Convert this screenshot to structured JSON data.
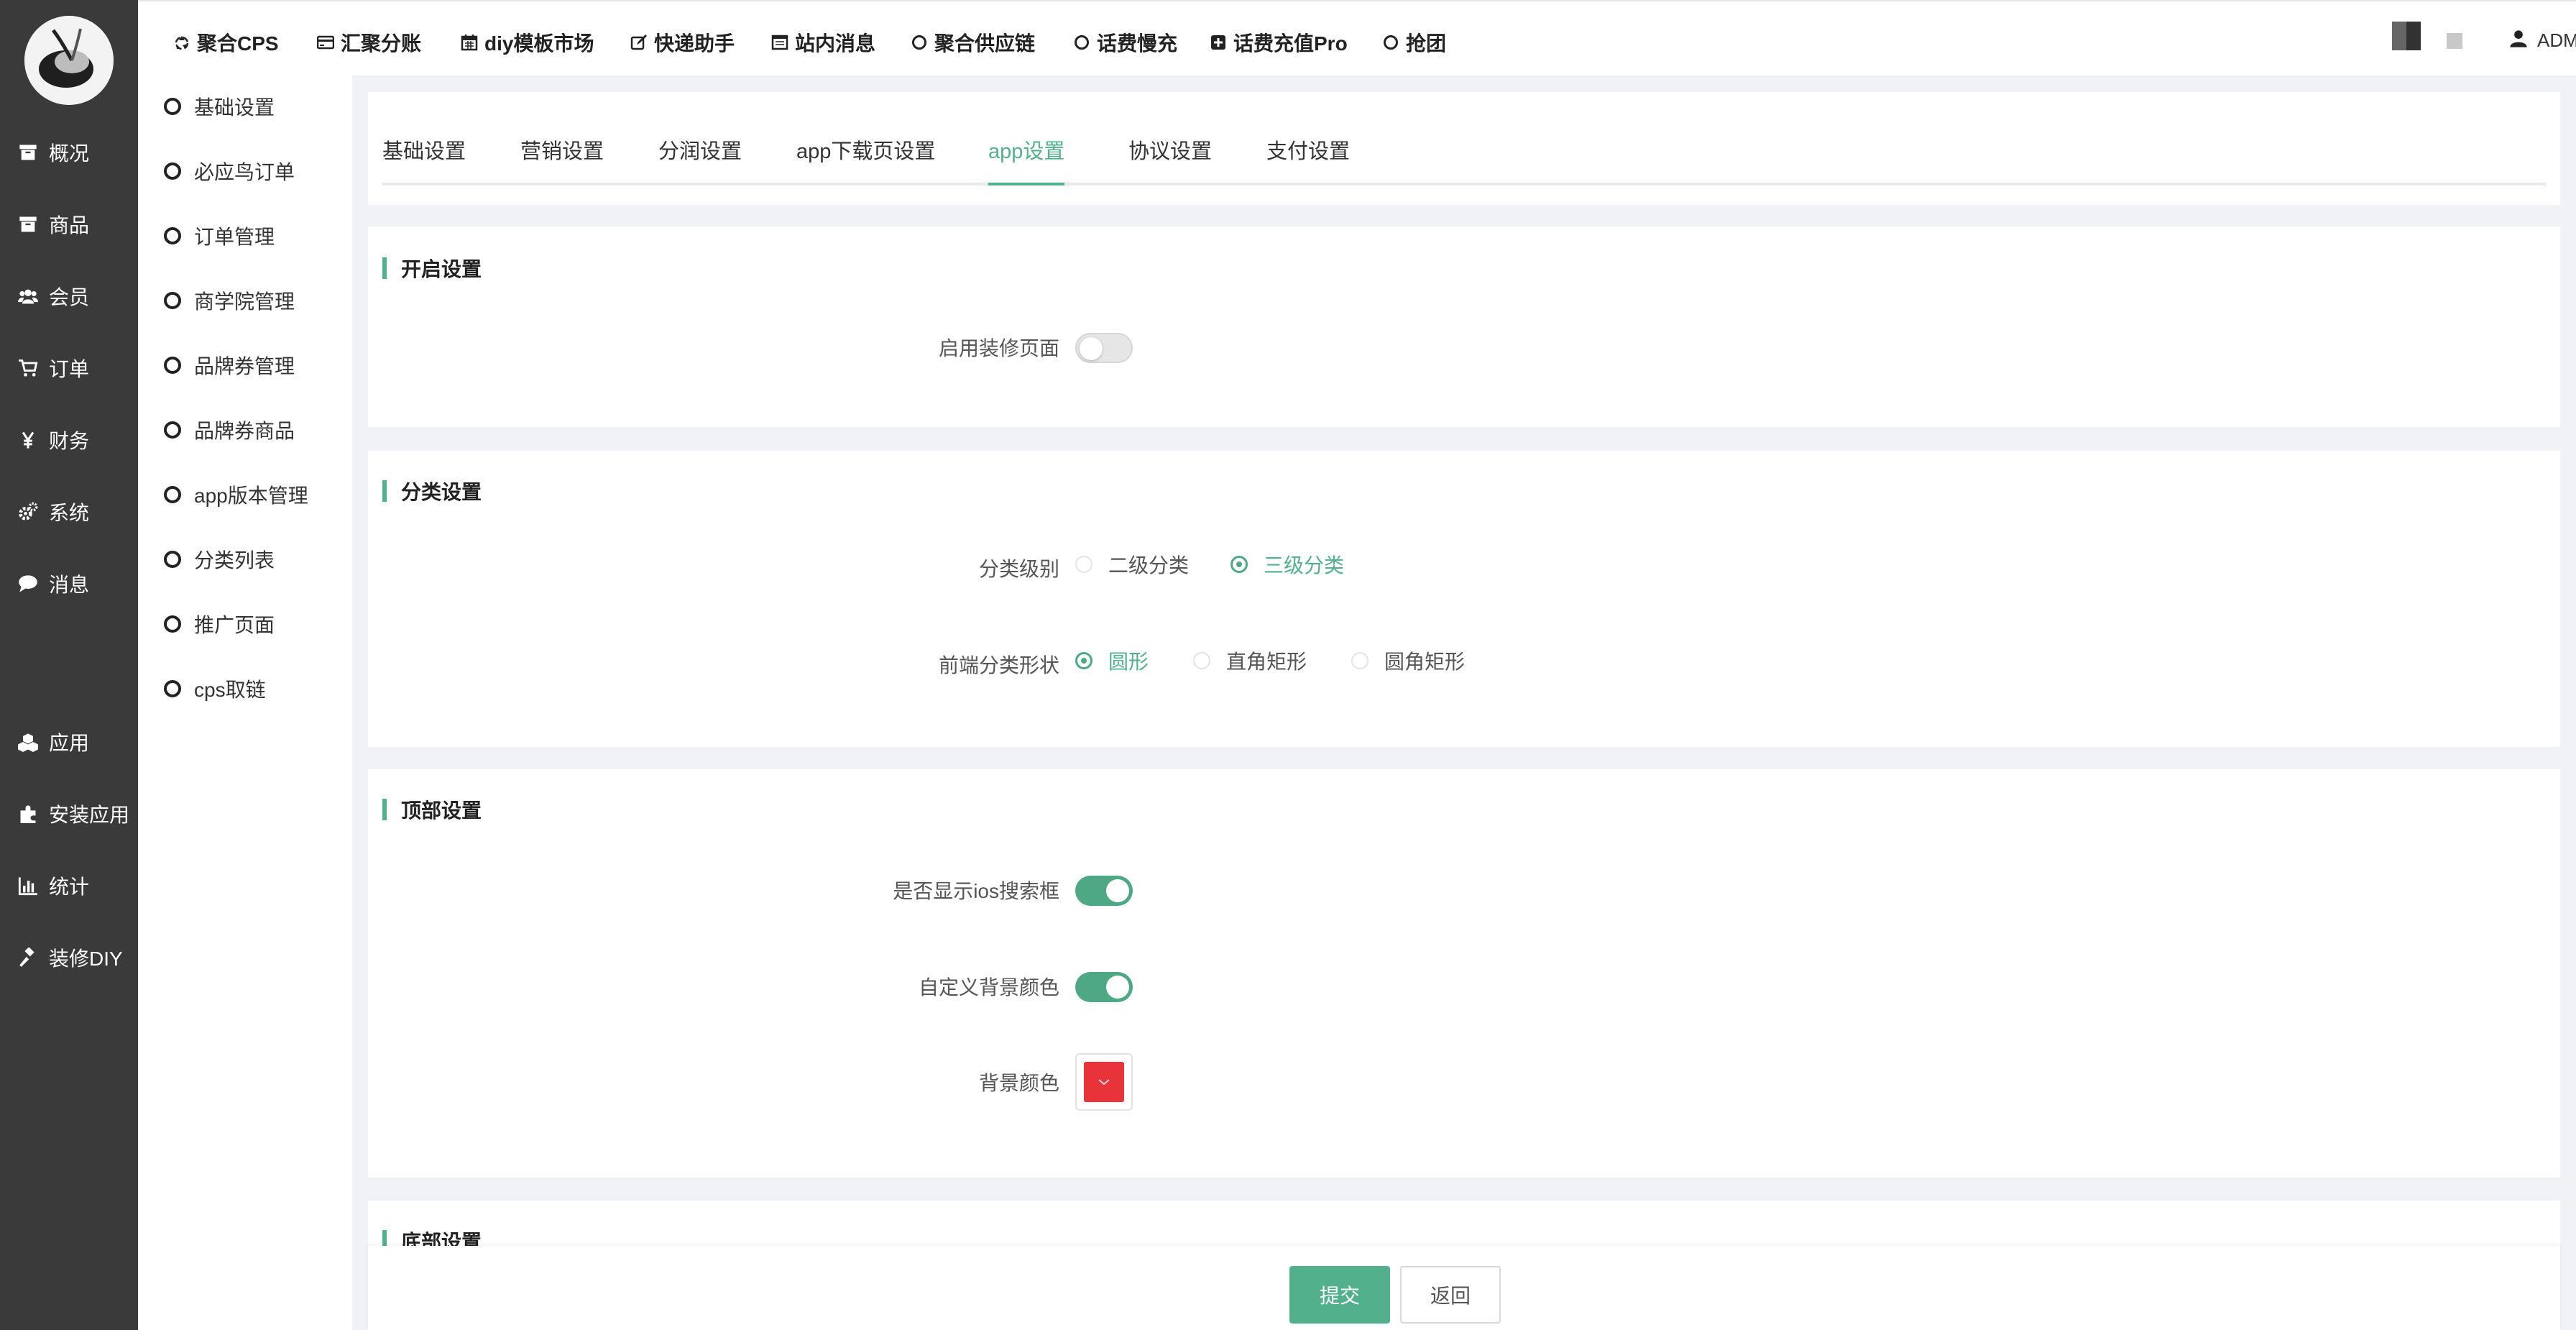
{
  "top_nav": [
    {
      "label": "聚合CPS",
      "icon": "recycle-icon"
    },
    {
      "label": "汇聚分账",
      "icon": "credit-card-icon"
    },
    {
      "label": "diy模板市场",
      "icon": "calendar-icon"
    },
    {
      "label": "快递助手",
      "icon": "edit-icon"
    },
    {
      "label": "站内消息",
      "icon": "window-icon"
    },
    {
      "label": "聚合供应链",
      "icon": "circle-icon"
    },
    {
      "label": "话费慢充",
      "icon": "circle-icon"
    },
    {
      "label": "话费充值Pro",
      "icon": "plus-square-icon"
    },
    {
      "label": "抢团",
      "icon": "circle-icon"
    }
  ],
  "user": {
    "label": "ADMIN(系统管理员)"
  },
  "sidebar": [
    {
      "label": "概况",
      "icon": "archive-icon"
    },
    {
      "label": "商品",
      "icon": "archive-icon"
    },
    {
      "label": "会员",
      "icon": "users-icon"
    },
    {
      "label": "订单",
      "icon": "cart-icon"
    },
    {
      "label": "财务",
      "icon": "yen-icon"
    },
    {
      "label": "系统",
      "icon": "cogs-icon"
    },
    {
      "label": "消息",
      "icon": "comment-icon"
    },
    {
      "label": "应用",
      "icon": "cubes-icon"
    },
    {
      "label": "安装应用",
      "icon": "puzzle-icon"
    },
    {
      "label": "统计",
      "icon": "bar-chart-icon"
    },
    {
      "label": "装修DIY",
      "icon": "gavel-icon"
    }
  ],
  "submenu": [
    {
      "label": "基础设置"
    },
    {
      "label": "必应鸟订单"
    },
    {
      "label": "订单管理"
    },
    {
      "label": "商学院管理"
    },
    {
      "label": "品牌券管理"
    },
    {
      "label": "品牌券商品"
    },
    {
      "label": "app版本管理"
    },
    {
      "label": "分类列表"
    },
    {
      "label": "推广页面"
    },
    {
      "label": "cps取链"
    }
  ],
  "tabs": [
    {
      "label": "基础设置"
    },
    {
      "label": "营销设置"
    },
    {
      "label": "分润设置"
    },
    {
      "label": "app下载页设置"
    },
    {
      "label": "app设置"
    },
    {
      "label": "协议设置"
    },
    {
      "label": "支付设置"
    }
  ],
  "active_tab": "app设置",
  "sections": {
    "open": {
      "title": "开启设置",
      "enable_decor_label": "启用装修页面",
      "enable_decor_on": false
    },
    "category": {
      "title": "分类设置",
      "level_label": "分类级别",
      "level_options": [
        "二级分类",
        "三级分类"
      ],
      "level_selected": "三级分类",
      "shape_label": "前端分类形状",
      "shape_options": [
        "圆形",
        "直角矩形",
        "圆角矩形"
      ],
      "shape_selected": "圆形"
    },
    "top": {
      "title": "顶部设置",
      "ios_search_label": "是否显示ios搜索框",
      "ios_search_on": true,
      "custom_bg_label": "自定义背景颜色",
      "custom_bg_on": true,
      "bg_color_label": "背景颜色",
      "bg_color": "#e8333a"
    },
    "bottom": {
      "title": "底部设置"
    }
  },
  "buttons": {
    "submit": "提交",
    "back": "返回"
  },
  "colors": {
    "accent": "#52b08c",
    "sidebar_bg": "#3a3a3a",
    "page_bg": "#f0f2f5"
  }
}
